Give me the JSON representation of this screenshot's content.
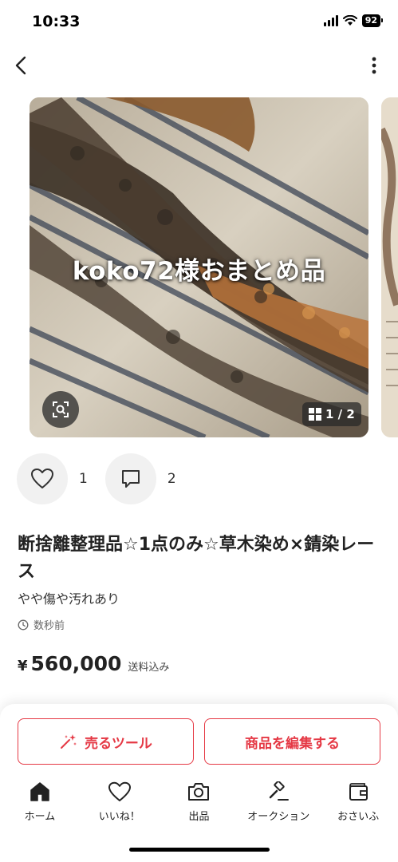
{
  "status_bar": {
    "time": "10:33",
    "battery": "92"
  },
  "photo": {
    "caption": "koko72様おまとめ品",
    "page_indicator": "1 / 2"
  },
  "social": {
    "likes_count": "1",
    "comments_count": "2"
  },
  "item": {
    "title": "断捨離整理品☆1点のみ☆草木染め×錆染レース",
    "condition": "やや傷や汚れあり",
    "posted_time": "数秒前",
    "currency_symbol": "¥",
    "price": "560,000",
    "shipping": "送料込み"
  },
  "actions": {
    "sell_tools_label": "売るツール",
    "edit_item_label": "商品を編集する"
  },
  "tabs": [
    {
      "label": "ホーム",
      "icon": "home-icon",
      "active": true
    },
    {
      "label": "いいね！",
      "icon": "heart-icon",
      "active": false
    },
    {
      "label": "出品",
      "icon": "camera-icon",
      "active": false
    },
    {
      "label": "オークション",
      "icon": "gavel-icon",
      "active": false
    },
    {
      "label": "おさいふ",
      "icon": "wallet-icon",
      "active": false
    }
  ],
  "colors": {
    "accent": "#e53945",
    "text": "#222222"
  }
}
